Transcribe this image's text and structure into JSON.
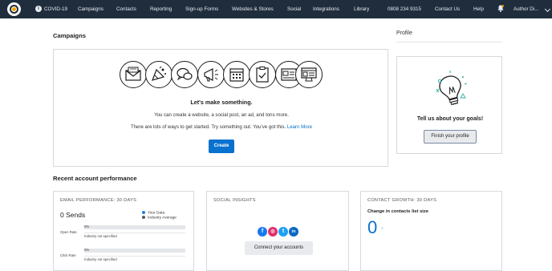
{
  "nav": {
    "items": [
      "COVID-19",
      "Campaigns",
      "Contacts",
      "Reporting",
      "Sign-up Forms",
      "Websites & Stores",
      "Social",
      "Integrations",
      "Library",
      "0808 234 9315",
      "Contact Us",
      "Help"
    ],
    "user": "Author Di...",
    "covid_icon_glyph": "i"
  },
  "campaigns": {
    "heading": "Campaigns",
    "title": "Let's make something.",
    "line1": "You can create a website, a social post, an ad, and tons more.",
    "line2": "There are lots of ways to get started. Try something out. You've got this.",
    "learn_more": "Learn More",
    "create_label": "Create",
    "icons": [
      "email-icon",
      "social-post-icon",
      "chat-icon",
      "megaphone-icon",
      "calendar-icon",
      "checklist-icon",
      "landing-page-icon",
      "website-icon"
    ]
  },
  "profile": {
    "tab": "Profile",
    "goals": "Tell us about your goals!",
    "button": "Finish your profile"
  },
  "recent": {
    "heading": "Recent account performance",
    "email": {
      "label": "EMAIL PERFORMANCE: 30 DAYS",
      "sends": "0 Sends",
      "legend_your": "Your Data",
      "legend_industry": "Industry Average",
      "rows": [
        {
          "label": "Open Rate",
          "pct": "0%",
          "note": "Industry not specified"
        },
        {
          "label": "Click Rate",
          "pct": "0%",
          "note": "Industry not specified"
        }
      ]
    },
    "social": {
      "label": "SOCIAL INSIGHTS",
      "icons": [
        {
          "name": "facebook-icon",
          "glyph": "f"
        },
        {
          "name": "instagram-icon",
          "glyph": "◎"
        },
        {
          "name": "twitter-icon",
          "glyph": "t"
        },
        {
          "name": "linkedin-icon",
          "glyph": "in"
        }
      ],
      "button": "Connect your accounts"
    },
    "growth": {
      "label": "CONTACT GROWTH: 30 DAYS",
      "title": "Change in contacts list size",
      "value": "0",
      "dash": "–"
    }
  },
  "colors": {
    "nav_bg": "#1f2d3d",
    "accent": "#0971ce",
    "brand_orange": "#f4a300",
    "your_data": "#1e7fe0",
    "industry": "#555c66",
    "facebook": "#1877f2",
    "instagram": "#e1306c",
    "twitter": "#1da1f2",
    "linkedin": "#0a66c2"
  }
}
